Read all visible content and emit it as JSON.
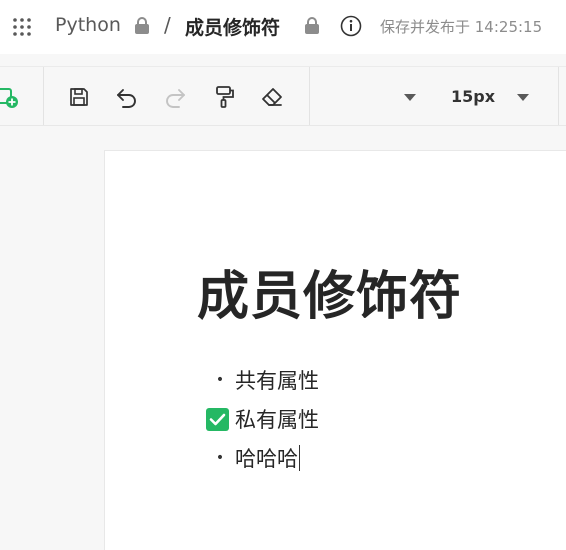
{
  "header": {
    "app_name": "Python",
    "separator": "/",
    "doc_title": "成员修饰符",
    "save_status": "保存并发布于 14:25:15"
  },
  "toolbar": {
    "font_size": "15px"
  },
  "document": {
    "heading": "成员修饰符",
    "items": [
      {
        "text": "共有属性",
        "type": "bullet"
      },
      {
        "text": "私有属性",
        "type": "checked"
      },
      {
        "text": "哈哈哈",
        "type": "bullet"
      }
    ]
  },
  "colors": {
    "accent_green": "#25b864"
  }
}
